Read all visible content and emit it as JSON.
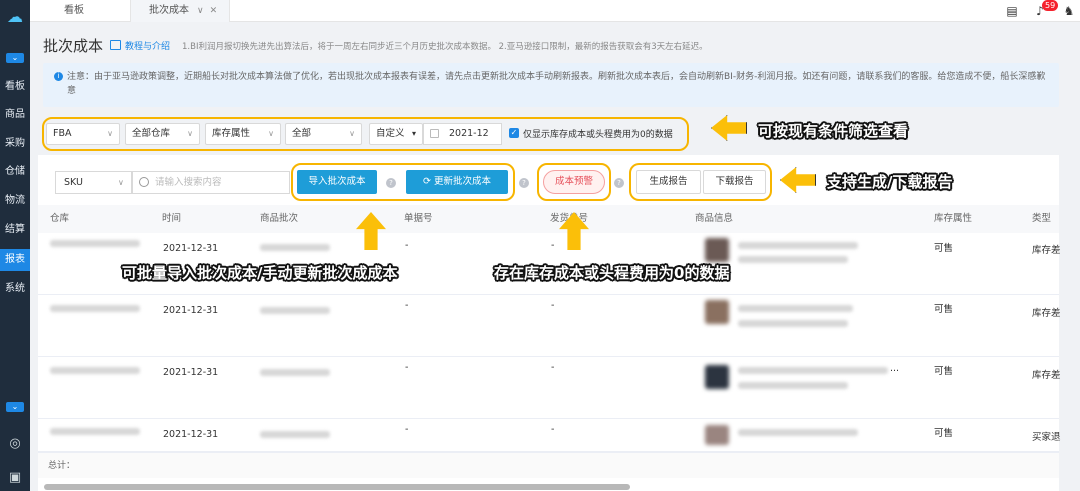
{
  "sidebar": {
    "items": [
      {
        "label": "看板"
      },
      {
        "label": "商品"
      },
      {
        "label": "采购"
      },
      {
        "label": "仓储"
      },
      {
        "label": "物流"
      },
      {
        "label": "结算"
      },
      {
        "label": "报表",
        "active": true
      },
      {
        "label": "系统"
      }
    ]
  },
  "tabs": [
    {
      "label": "看板"
    },
    {
      "label": "批次成本"
    }
  ],
  "header": {
    "notification_count": "59"
  },
  "page": {
    "title": "批次成本",
    "tutorial_link": "教程与介绍",
    "note": "1.BI利润月报切换先进先出算法后，将于一周左右同步近三个月历史批次成本数据。 2.亚马逊接口限制，最新的报告获取会有3天左右延迟。"
  },
  "notice": {
    "text": "注意：由于亚马逊政策调整，近期船长对批次成本算法做了优化，若出现批次成本报表有误差，请先点击更新批次成本手动刷新报表。刷新批次成本表后，会自动刷新BI-财务-利润月报。如还有问题，请联系我们的客服。给您造成不便，船长深感歉意"
  },
  "filters": {
    "channel": "FBA",
    "warehouse": "全部仓库",
    "inventory_attr": "库存属性",
    "all": "全部",
    "date_mode": "自定义",
    "month": "2021-12",
    "only_zero_label": "仅显示库存成本或头程费用为0的数据"
  },
  "toolbar": {
    "sku_select": "SKU",
    "search_placeholder": "请输入搜索内容",
    "import_btn": "导入批次成本",
    "refresh_btn": "更新批次成本",
    "cost_warning_btn": "成本预警",
    "generate_report_btn": "生成报告",
    "download_report_btn": "下载报告"
  },
  "annotations": {
    "filter": "可按现有条件筛选查看",
    "report": "支持生成/下载报告",
    "import": "可批量导入批次成本/手动更新批次成成本",
    "zero": "存在库存成本或头程费用为0的数据"
  },
  "table": {
    "columns": [
      "仓库",
      "时间",
      "商品批次",
      "单据号",
      "发货单号",
      "商品信息",
      "库存属性",
      "类型"
    ],
    "rows": [
      {
        "time": "2021-12-31",
        "doc": "-",
        "ship": "-",
        "attr": "可售",
        "type": "库存差"
      },
      {
        "time": "2021-12-31",
        "doc": "-",
        "ship": "-",
        "attr": "可售",
        "type": "库存差"
      },
      {
        "time": "2021-12-31",
        "doc": "-",
        "ship": "-",
        "attr": "可售",
        "type": "库存差",
        "more": "..."
      },
      {
        "time": "2021-12-31",
        "doc": "-",
        "ship": "-",
        "attr": "可售",
        "type": "买家退"
      }
    ],
    "total_label": "总计："
  }
}
